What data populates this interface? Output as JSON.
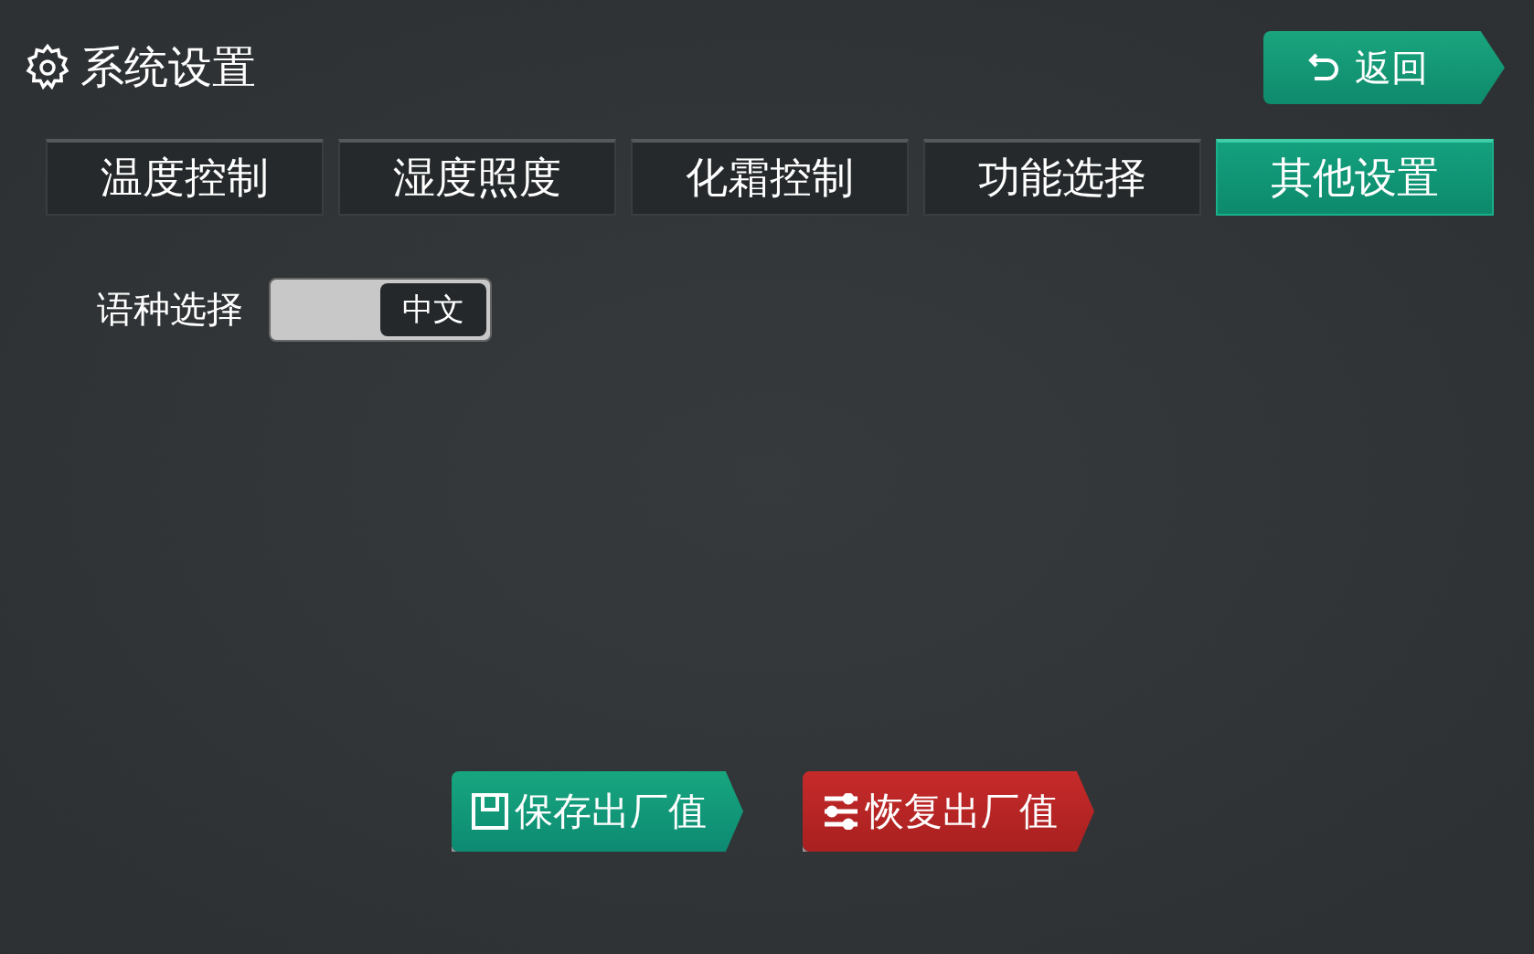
{
  "header": {
    "title": "系统设置",
    "back_button": "返回"
  },
  "tabs": [
    {
      "label": "温度控制",
      "selected": false
    },
    {
      "label": "湿度照度",
      "selected": false
    },
    {
      "label": "化霜控制",
      "selected": false
    },
    {
      "label": "功能选择",
      "selected": false
    },
    {
      "label": "其他设置",
      "selected": true
    }
  ],
  "language": {
    "label": "语种选择",
    "value": "中文",
    "on": true
  },
  "actions": [
    {
      "label": "保存出厂值",
      "kind": "save"
    },
    {
      "label": "恢复出厂值",
      "kind": "restore"
    }
  ]
}
